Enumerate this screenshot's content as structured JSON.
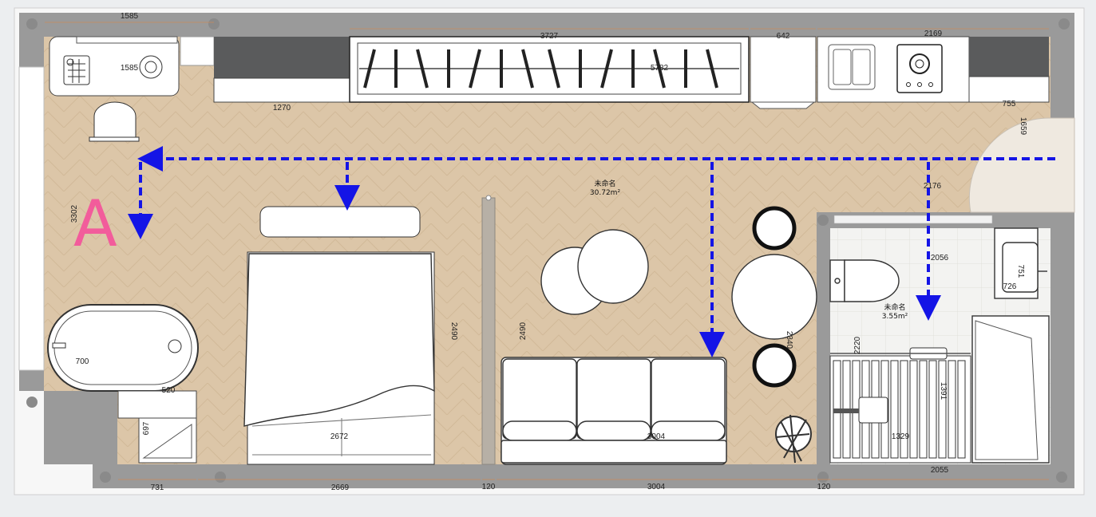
{
  "plan": {
    "room_main": {
      "name": "未命名",
      "area": "30.72m²"
    },
    "room_bath": {
      "name": "未命名",
      "area": "3.55m²"
    },
    "marker_letter": "A",
    "colors": {
      "floor": "#dcc6a8",
      "wall": "#9a9a9a",
      "route_arrow": "#1414e6",
      "marker": "#f25c9b",
      "dimension_line": "#c98a5a"
    },
    "dimensions": {
      "top_left": "1585",
      "top_mid": "3727",
      "top_642": "642",
      "top_right": "2169",
      "stove_1585": "1585",
      "wardrobe_5782": "5782",
      "cab_1270": "1270",
      "right_755": "755",
      "right_1659": "1659",
      "left_3302": "3302",
      "corridor_2176": "2176",
      "bath_2056": "2056",
      "sink_751": "751",
      "sink_726": "726",
      "partition_2490_left": "2490",
      "partition_2490_right": "2490",
      "dining_2340": "2340",
      "shower_2220": "2220",
      "shower_1391": "1391",
      "shower_1329": "1329",
      "tub_700": "700",
      "tub_520": "520",
      "nightstand_697": "697",
      "bed_2672": "2672",
      "sofa_3004": "3004",
      "bottom_731": "731",
      "bottom_2669": "2669",
      "bottom_120a": "120",
      "bottom_3004": "3004",
      "bottom_120b": "120",
      "bottom_2055": "2055"
    }
  }
}
